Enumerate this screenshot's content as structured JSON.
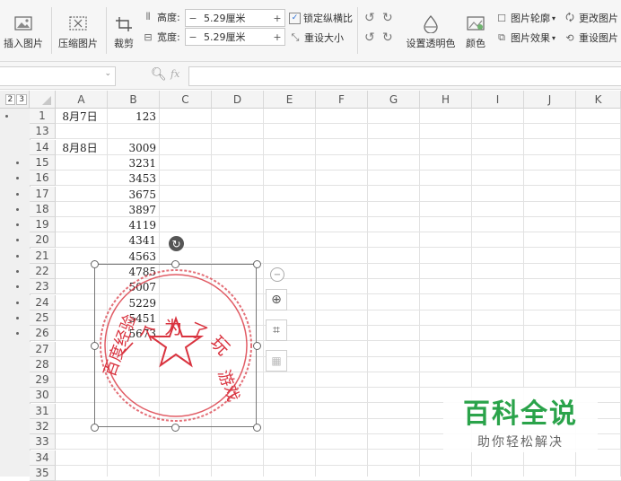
{
  "ribbon": {
    "insert_picture": "插入图片",
    "compress_picture": "压缩图片",
    "crop": "裁剪",
    "height_label": "高度:",
    "height_value": "5.29厘米",
    "width_label": "宽度:",
    "width_value": "5.29厘米",
    "lock_ratio": "锁定纵横比",
    "reset_size": "重设大小",
    "set_transparent": "设置透明色",
    "color": "颜色",
    "outline": "图片轮廓",
    "effects": "图片效果",
    "change_picture": "更改图片",
    "reset_picture": "重设图片"
  },
  "formula_bar": {
    "fx": "fx"
  },
  "group_levels": [
    "2",
    "3"
  ],
  "columns": [
    "A",
    "B",
    "C",
    "D",
    "E",
    "F",
    "G",
    "H",
    "I",
    "J",
    "K"
  ],
  "rows": [
    "1",
    "13",
    "14",
    "15",
    "16",
    "17",
    "18",
    "19",
    "20",
    "21",
    "22",
    "23",
    "24",
    "25",
    "26",
    "27",
    "28",
    "29",
    "30",
    "31",
    "32",
    "33",
    "34",
    "35"
  ],
  "cells": {
    "A1": "8月7日",
    "B1": "123",
    "A14": "8月8日",
    "B": [
      "3009",
      "3231",
      "3453",
      "3675",
      "3897",
      "4119",
      "4341",
      "4563",
      "4785",
      "5007",
      "5229",
      "5451",
      "5673"
    ]
  },
  "stamp": {
    "top_text": "一个为了玩",
    "left_text": "百度经验",
    "right_text": "游戏",
    "color": "#d9333f"
  },
  "watermark": {
    "title": "百科全说",
    "subtitle": "助你轻松解决",
    "color": "#2aa34a"
  }
}
